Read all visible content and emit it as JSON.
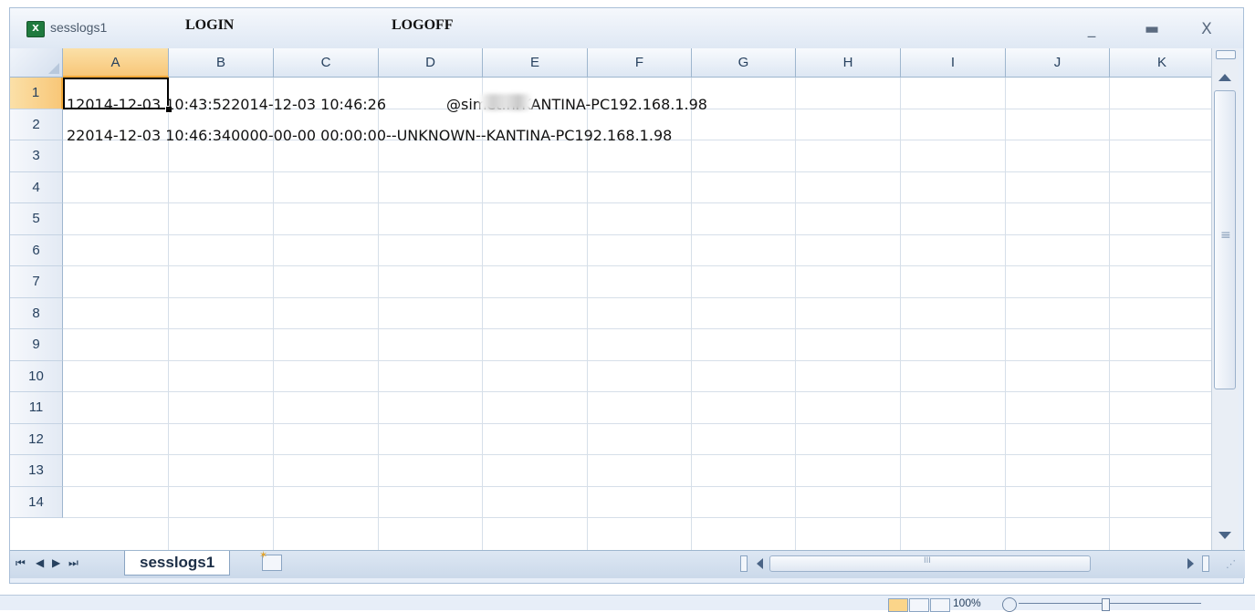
{
  "window": {
    "title": "sesslogs1",
    "app_icon": "X",
    "annotation_login": "LOGIN",
    "annotation_logoff": "LOGOFF",
    "minimize": "_",
    "maximize": "▬",
    "close": "X"
  },
  "columns": [
    "A",
    "B",
    "C",
    "D",
    "E",
    "F",
    "G",
    "H",
    "I",
    "J",
    "K"
  ],
  "rows": [
    "1",
    "2",
    "3",
    "4",
    "5",
    "6",
    "7",
    "8",
    "9",
    "10",
    "11",
    "12",
    "13",
    "14"
  ],
  "cells": {
    "row1_a": "12014-12-03 10:43:522014-12-03 10:46:26",
    "row1_rest": "@simet.hrKANTINA-PC192.168.1.98",
    "row2_a": "22014-12-03 10:46:340000-00-00 00:00:00--UNKNOWN--KANTINA-PC192.168.1.98"
  },
  "selection": {
    "column": "A",
    "row": "1"
  },
  "sheet_tabs": {
    "active": "sesslogs1"
  },
  "nav": {
    "first": "⏮",
    "prev": "◀",
    "next": "▶",
    "last": "⏭"
  },
  "status": {
    "zoom": "100%"
  },
  "colors": {
    "selected_header": "#f8c778",
    "header_bg": "#dde7f3",
    "grid_line": "#d6dfe9"
  }
}
